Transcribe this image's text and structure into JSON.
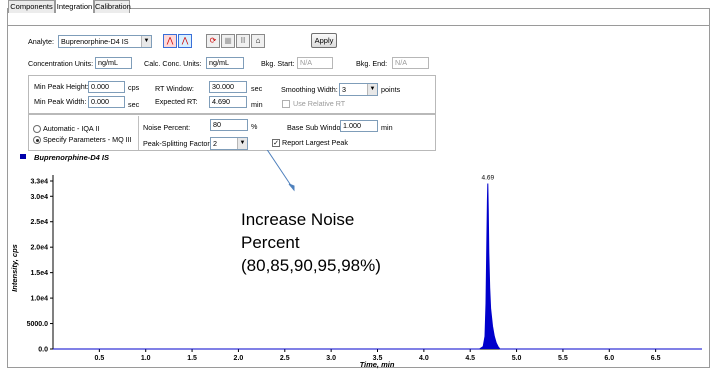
{
  "tabs": [
    {
      "label": "Components"
    },
    {
      "label": "Integration"
    },
    {
      "label": "Calibration"
    }
  ],
  "toolbar": {
    "analyte_label": "Analyte:",
    "analyte_value": "Buprenorphine-D4 IS",
    "apply_label": "Apply"
  },
  "units_row": {
    "conc_units_label": "Concentration Units:",
    "conc_units_value": "ng/mL",
    "calc_conc_units_label": "Calc. Conc. Units:",
    "calc_conc_units_value": "ng/mL",
    "bkg_start_label": "Bkg. Start:",
    "bkg_start_value": "N/A",
    "bkg_end_label": "Bkg. End:",
    "bkg_end_value": "N/A"
  },
  "peak_params": {
    "min_peak_height_label": "Min Peak Height:",
    "min_peak_height_value": "0.000",
    "min_peak_height_unit": "cps",
    "min_peak_width_label": "Min Peak Width:",
    "min_peak_width_value": "0.000",
    "min_peak_width_unit": "sec",
    "rt_window_label": "RT Window:",
    "rt_window_value": "30.000",
    "rt_window_unit": "sec",
    "expected_rt_label": "Expected RT:",
    "expected_rt_value": "4.690",
    "expected_rt_unit": "min",
    "smoothing_width_label": "Smoothing Width:",
    "smoothing_width_value": "3",
    "smoothing_width_unit": "points",
    "use_relative_rt_label": "Use Relative RT"
  },
  "algorithm": {
    "automatic_label": "Automatic - IQA II",
    "specify_label": "Specify Parameters - MQ III",
    "noise_percent_label": "Noise Percent:",
    "noise_percent_value": "80",
    "noise_percent_unit": "%",
    "base_sub_window_label": "Base Sub Window:",
    "base_sub_window_value": "1.000",
    "base_sub_window_unit": "min",
    "peak_splitting_label": "Peak-Splitting Factor:",
    "peak_splitting_value": "2",
    "report_largest_peak_label": "Report Largest Peak"
  },
  "chart_data": {
    "type": "line",
    "title": "Buprenorphine-D4 IS",
    "xlabel": "Time, min",
    "ylabel": "Intensity, cps",
    "xlim": [
      0.0,
      7.0
    ],
    "ylim": [
      0.0,
      33000
    ],
    "x_ticks": [
      "0.5",
      "1.0",
      "1.5",
      "2.0",
      "2.5",
      "3.0",
      "3.5",
      "4.0",
      "4.5",
      "5.0",
      "5.5",
      "6.0",
      "6.5"
    ],
    "y_ticks": [
      "0.0",
      "5000.0",
      "1.0e4",
      "1.5e4",
      "2.0e4",
      "2.5e4",
      "3.0e4",
      "3.3e4"
    ],
    "series_color": "#0000cc",
    "peak_label": "4.69",
    "series": [
      {
        "x": [
          0.0,
          4.6,
          4.64,
          4.66,
          4.67,
          4.68,
          4.685,
          4.69,
          4.695,
          4.7,
          4.71,
          4.72,
          4.74,
          4.76,
          4.78,
          4.8,
          4.82,
          7.0
        ],
        "y": [
          0,
          0,
          500,
          2500,
          9000,
          22000,
          29000,
          32500,
          27000,
          19000,
          12000,
          8000,
          4500,
          2500,
          1200,
          500,
          0,
          0
        ]
      }
    ]
  },
  "annotation": {
    "line1": "Increase Noise",
    "line2": "Percent",
    "line3": "(80,85,90,95,98%)"
  },
  "colors": {
    "trace": "#0000cc",
    "legend_marker": "#0000aa",
    "field_border": "#7f9db9"
  },
  "icons": [
    "peak-a-icon",
    "peak-b-icon",
    "refresh-icon",
    "grid-icon",
    "bars-icon",
    "lock-icon",
    "dropdown-arrow-icon"
  ]
}
